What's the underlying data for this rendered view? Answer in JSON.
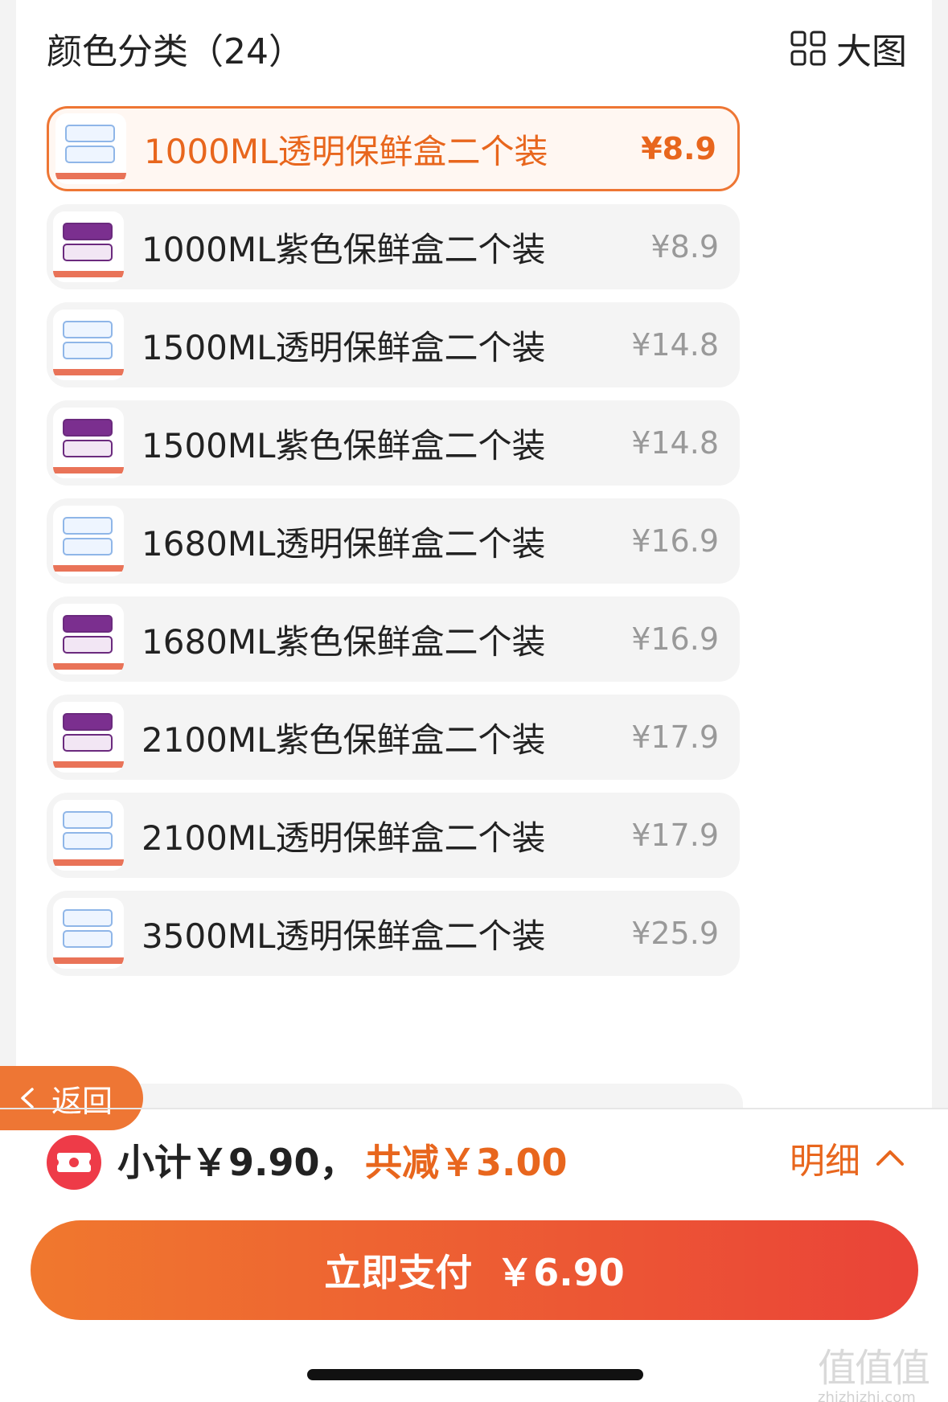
{
  "header": {
    "title": "颜色分类（24）",
    "big_view_label": "大图",
    "big_view_icon": "grid-icon"
  },
  "variants": [
    {
      "name": "1000ML透明保鲜盒二个装",
      "price": "¥8.9",
      "color": "clear",
      "selected": true
    },
    {
      "name": "1000ML紫色保鲜盒二个装",
      "price": "¥8.9",
      "color": "purple",
      "selected": false
    },
    {
      "name": "1500ML透明保鲜盒二个装",
      "price": "¥14.8",
      "color": "clear",
      "selected": false
    },
    {
      "name": "1500ML紫色保鲜盒二个装",
      "price": "¥14.8",
      "color": "purple",
      "selected": false
    },
    {
      "name": "1680ML透明保鲜盒二个装",
      "price": "¥16.9",
      "color": "clear",
      "selected": false
    },
    {
      "name": "1680ML紫色保鲜盒二个装",
      "price": "¥16.9",
      "color": "purple",
      "selected": false
    },
    {
      "name": "2100ML紫色保鲜盒二个装",
      "price": "¥17.9",
      "color": "purple",
      "selected": false
    },
    {
      "name": "2100ML透明保鲜盒二个装",
      "price": "¥17.9",
      "color": "clear",
      "selected": false
    },
    {
      "name": "3500ML透明保鲜盒二个装",
      "price": "¥25.9",
      "color": "clear",
      "selected": false
    }
  ],
  "back": {
    "label": "返回",
    "icon": "chevron-left-icon"
  },
  "summary": {
    "subtotal": "小计￥9.90，",
    "discount": "共减￥3.00",
    "detail_label": "明细",
    "detail_icon": "chevron-up-icon",
    "coupon_icon": "coupon-icon"
  },
  "pay": {
    "label": "立即支付",
    "amount": "￥6.90"
  },
  "watermark": {
    "glyphs": "值值值",
    "text": "zhizhizhi.com"
  },
  "colors": {
    "accent": "#ee7634",
    "accent_text": "#e8661d",
    "pay_gradient_start": "#f0782e",
    "pay_gradient_end": "#ea4338",
    "item_bg": "#f4f4f4",
    "selected_bg": "#fff7f2"
  }
}
